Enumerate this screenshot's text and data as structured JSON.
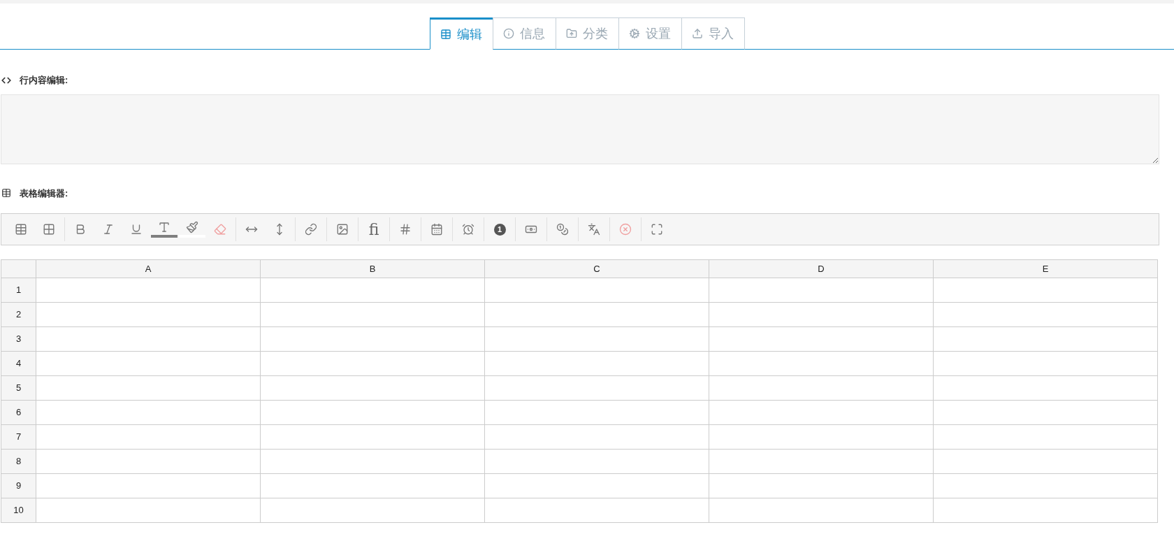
{
  "tabs": [
    {
      "label": "编辑",
      "kind": "table",
      "selected": true
    },
    {
      "label": "信息",
      "kind": "info",
      "selected": false
    },
    {
      "label": "分类",
      "kind": "folder",
      "selected": false
    },
    {
      "label": "设置",
      "kind": "gears",
      "selected": false
    },
    {
      "label": "导入",
      "kind": "upload",
      "selected": false
    }
  ],
  "inline_editor": {
    "heading": "行内容编辑:"
  },
  "table_editor": {
    "heading": "表格编辑器:",
    "toolbar": [
      [
        {
          "kind": "table"
        },
        {
          "kind": "grid"
        }
      ],
      [
        {
          "kind": "bold"
        },
        {
          "kind": "italic"
        },
        {
          "kind": "underline"
        },
        {
          "kind": "text-color",
          "color": "#7f7f7f"
        },
        {
          "kind": "highlight",
          "color": "#ffffff"
        },
        {
          "kind": "eraser"
        }
      ],
      [
        {
          "kind": "width"
        },
        {
          "kind": "height"
        }
      ],
      [
        {
          "kind": "link"
        }
      ],
      [
        {
          "kind": "image"
        }
      ],
      [
        {
          "kind": "glyph",
          "text": "fi"
        }
      ],
      [
        {
          "kind": "hash"
        }
      ],
      [
        {
          "kind": "calendar"
        }
      ],
      [
        {
          "kind": "alarm"
        }
      ],
      [
        {
          "kind": "badge",
          "text": "1"
        }
      ],
      [
        {
          "kind": "banknote"
        }
      ],
      [
        {
          "kind": "coins"
        }
      ],
      [
        {
          "kind": "translate"
        }
      ],
      [
        {
          "kind": "remove"
        }
      ],
      [
        {
          "kind": "fullscreen"
        }
      ]
    ],
    "columns": [
      "A",
      "B",
      "C",
      "D",
      "E"
    ],
    "rows": [
      "1",
      "2",
      "3",
      "4",
      "5",
      "6",
      "7",
      "8",
      "9",
      "10"
    ]
  }
}
